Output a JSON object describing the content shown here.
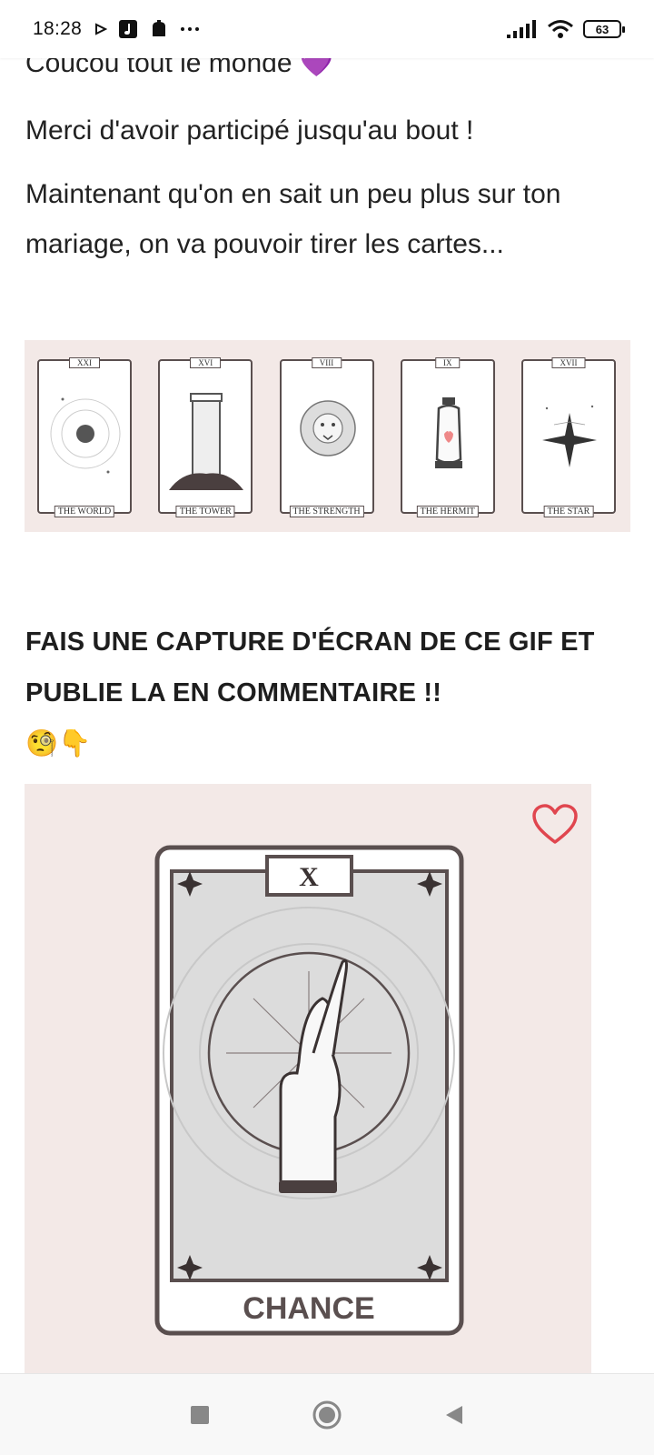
{
  "status_bar": {
    "time": "18:28",
    "battery": "63"
  },
  "post": {
    "greeting": "Coucou tout le monde 💜",
    "thanks": "Merci d'avoir participé jusqu'au bout !",
    "intro": "Maintenant qu'on en sait un peu plus sur ton mariage, on va pouvoir tirer les cartes...",
    "tarot_cards": [
      {
        "numeral": "XXI",
        "name": "THE WORLD"
      },
      {
        "numeral": "XVI",
        "name": "THE TOWER"
      },
      {
        "numeral": "VIII",
        "name": "THE STRENGTH"
      },
      {
        "numeral": "IX",
        "name": "THE HERMIT"
      },
      {
        "numeral": "XVII",
        "name": "THE STAR"
      }
    ],
    "instruction": "FAIS UNE CAPTURE D'ÉCRAN DE CE GIF ET PUBLIE LA EN COMMENTAIRE !!",
    "instruction_emoji": "🧐👇",
    "gif_card": {
      "numeral": "X",
      "name": "CHANCE"
    }
  },
  "colors": {
    "panel_bg": "#f3e9e7",
    "heart": "#e0464f",
    "card_outline": "#5a4f4f"
  },
  "icons": {
    "nav_recents": "square-icon",
    "nav_home": "circle-icon",
    "nav_back": "triangle-icon",
    "like": "heart-outline-icon"
  }
}
